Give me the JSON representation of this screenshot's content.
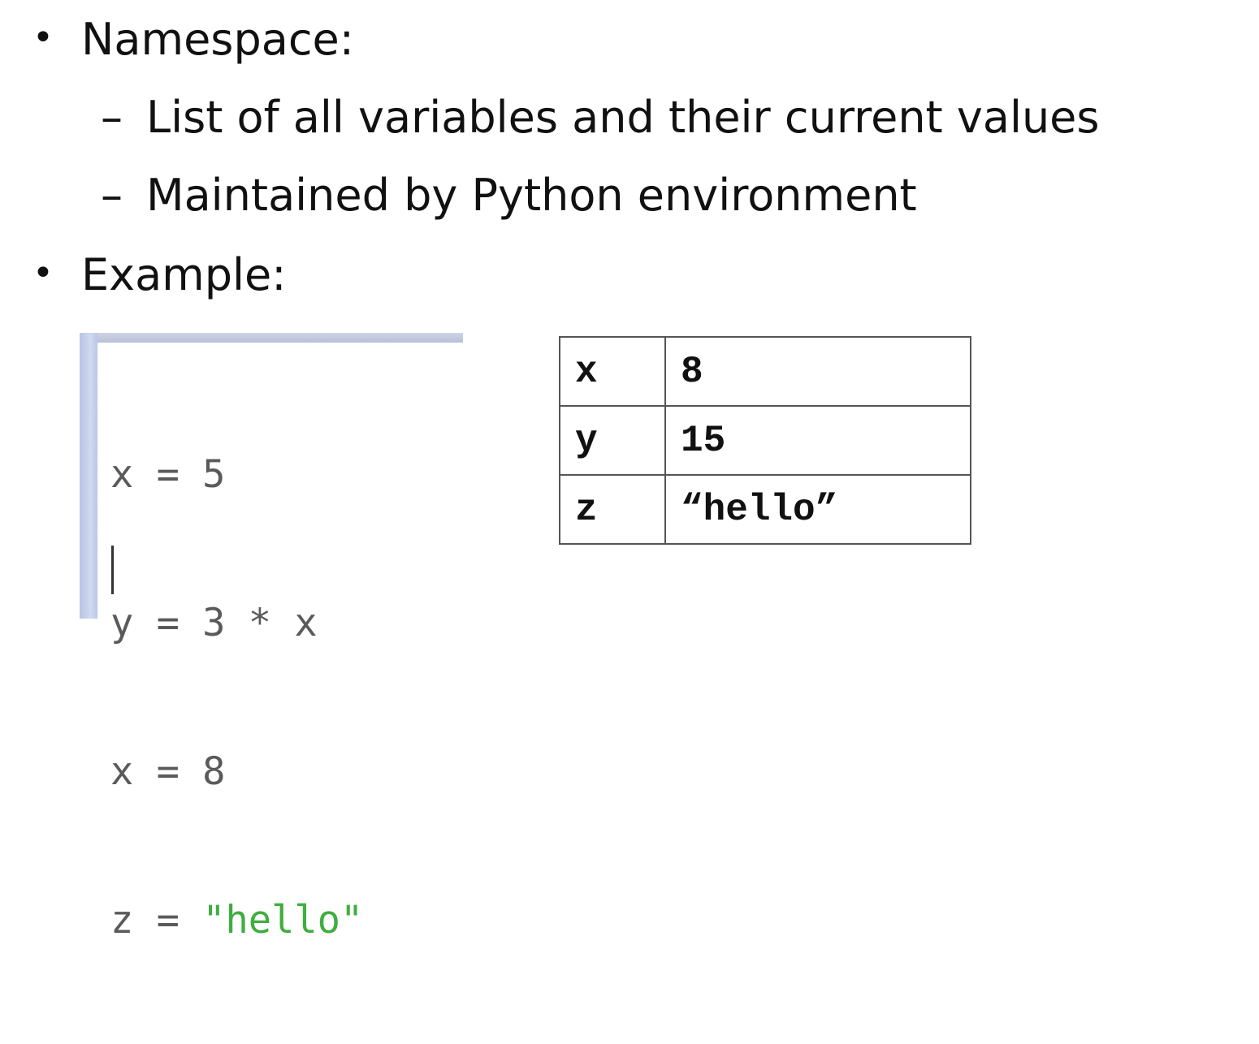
{
  "bullets": {
    "namespace": "Namespace:",
    "namespace_sub": [
      "List of all variables and their current values",
      "Maintained by Python environment"
    ],
    "example": "Example:"
  },
  "symbols": {
    "bullet": "•",
    "dash": "–"
  },
  "code": {
    "line1": "x = 5",
    "line2": "y = 3 * x",
    "line3": "x = 8",
    "line4_prefix": "z = ",
    "line4_string": "\"hello\""
  },
  "table": {
    "rows": [
      {
        "name": "x",
        "value": "8"
      },
      {
        "name": "y",
        "value": "15"
      },
      {
        "name": "z",
        "value": "“hello”"
      }
    ]
  },
  "colors": {
    "string_literal": "#3fae3f",
    "code_text": "#5a5a5a",
    "gutter": "#b7c5e4"
  }
}
